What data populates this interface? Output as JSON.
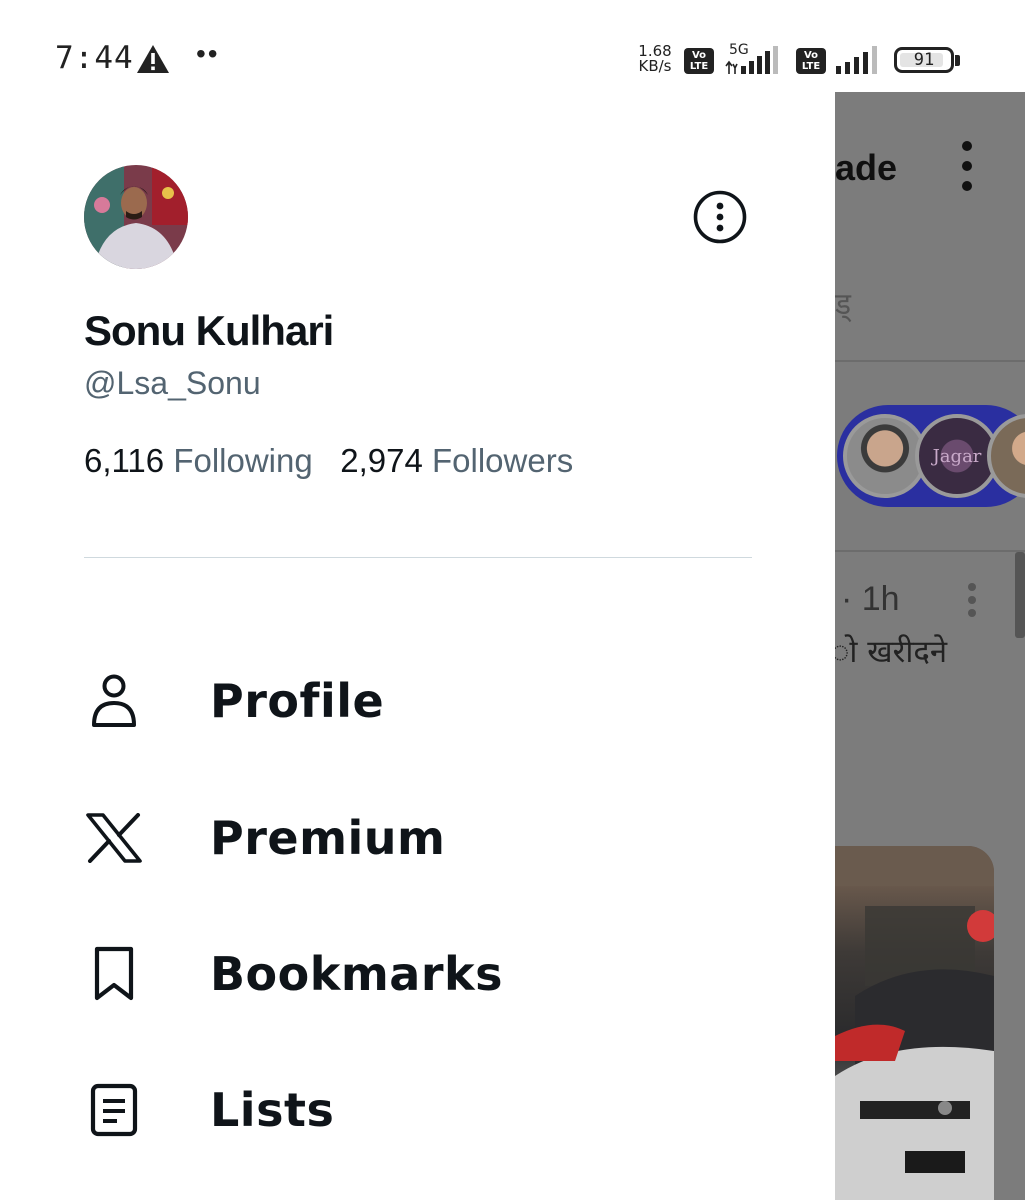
{
  "status_bar": {
    "time": "7:44",
    "dots": "••",
    "net_speed_value": "1.68",
    "net_speed_unit": "KB/s",
    "volte_label": "Vo LTE",
    "network_type": "5G",
    "battery_level": "91",
    "battery_fraction": 0.91
  },
  "drawer": {
    "profile": {
      "name": "Sonu Kulhari",
      "handle": "@Lsa_Sonu",
      "following_count": "6,116",
      "following_label": "Following",
      "followers_count": "2,974",
      "followers_label": "Followers"
    },
    "menu": [
      {
        "label": "Profile",
        "icon": "person-icon"
      },
      {
        "label": "Premium",
        "icon": "x-logo-icon"
      },
      {
        "label": "Bookmarks",
        "icon": "bookmark-icon"
      },
      {
        "label": "Lists",
        "icon": "lists-icon"
      }
    ]
  },
  "background_timeline": {
    "title_fragment": "ade",
    "tab_fragment": "ड्",
    "post_time": "· 1h",
    "post_text_fragment": "ो खरीदने",
    "fleet_label_fragment": "Jagar"
  },
  "colors": {
    "text_primary": "#0f1419",
    "text_secondary": "#536471",
    "divider": "#cfd9de",
    "scrim": "#7c7c7c"
  }
}
